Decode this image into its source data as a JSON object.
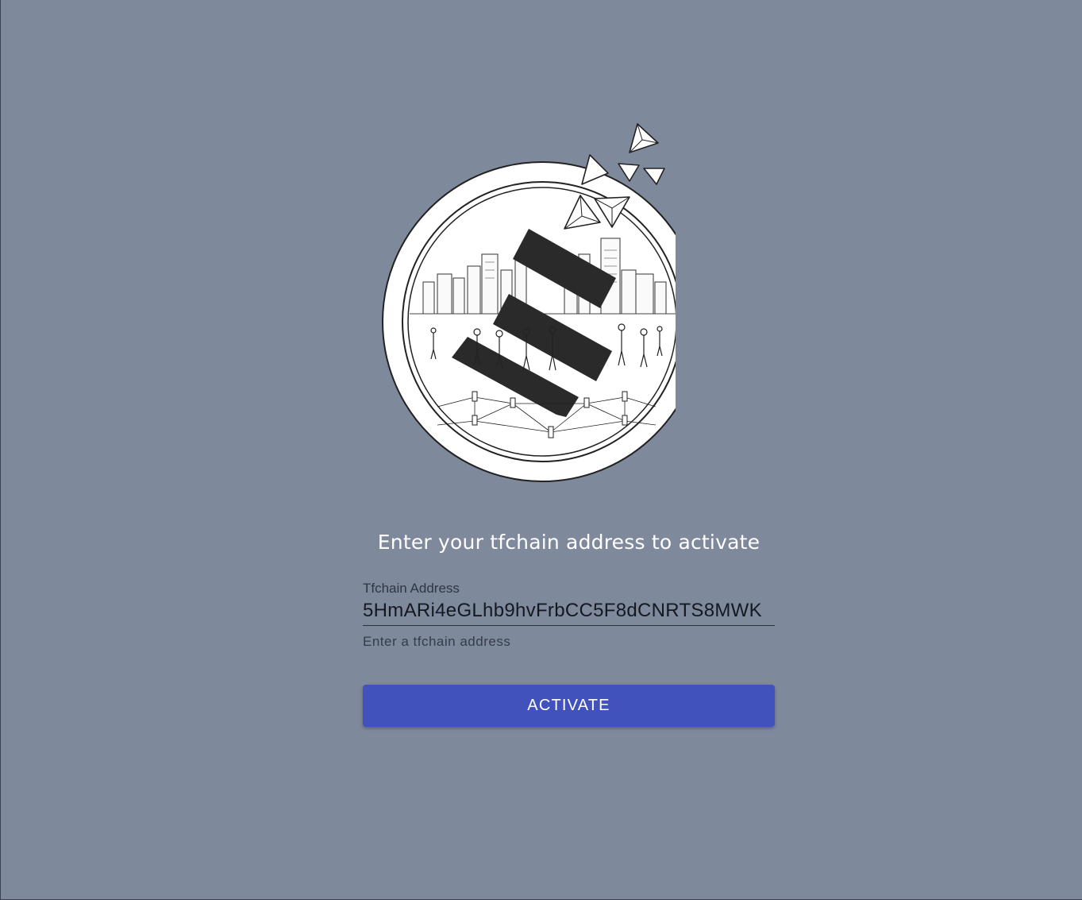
{
  "heading": "Enter your tfchain address to activate",
  "form": {
    "label": "Tfchain Address",
    "value": "5HmARi4eGLhb9hvFrbCC5F8dCNRTS8MWK",
    "hint": "Enter a tfchain address"
  },
  "button": {
    "label": "ACTIVATE"
  },
  "colors": {
    "background": "#7f899c",
    "button": "#4152bd"
  }
}
